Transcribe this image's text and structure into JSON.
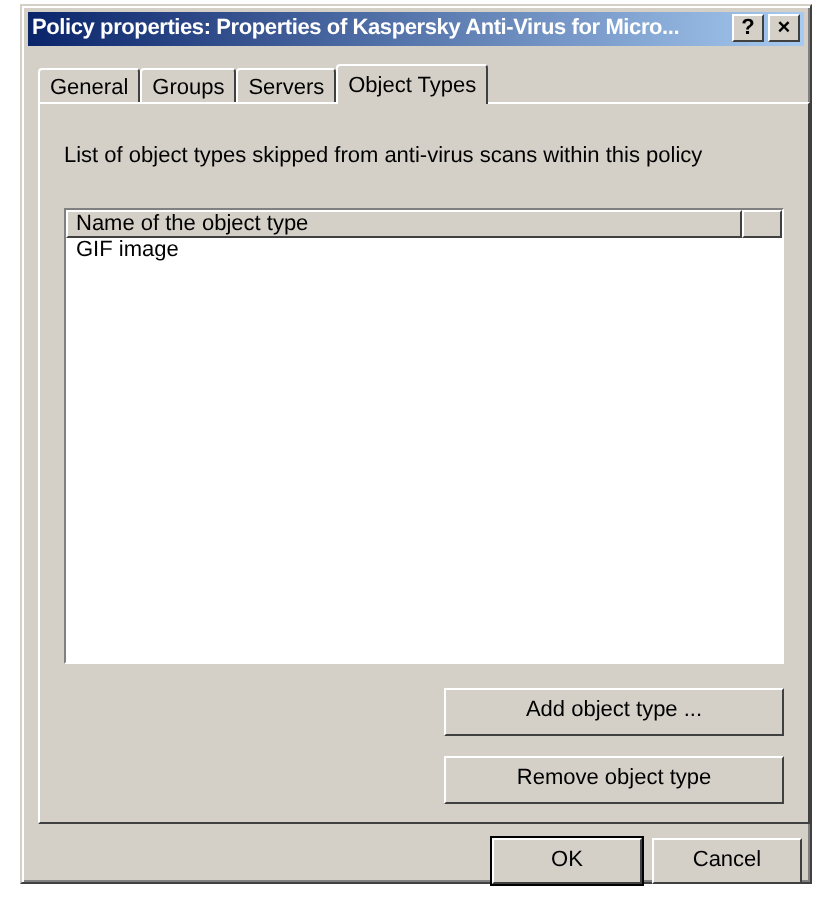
{
  "window": {
    "title": "Policy properties: Properties of Kaspersky Anti-Virus for Micro...",
    "help_button": "?",
    "close_button": "×"
  },
  "tabs": [
    {
      "label": "General",
      "selected": false
    },
    {
      "label": "Groups",
      "selected": false
    },
    {
      "label": "Servers",
      "selected": false
    },
    {
      "label": "Object Types",
      "selected": true
    }
  ],
  "description": "List of object types skipped from anti-virus scans within this policy",
  "list": {
    "columns": [
      "Name of the object type"
    ],
    "rows": [
      "GIF image"
    ]
  },
  "panel_buttons": [
    "Add object type ...",
    "Remove object type"
  ],
  "dialog_buttons": [
    {
      "label": "OK",
      "default": true
    },
    {
      "label": "Cancel",
      "default": false
    }
  ]
}
